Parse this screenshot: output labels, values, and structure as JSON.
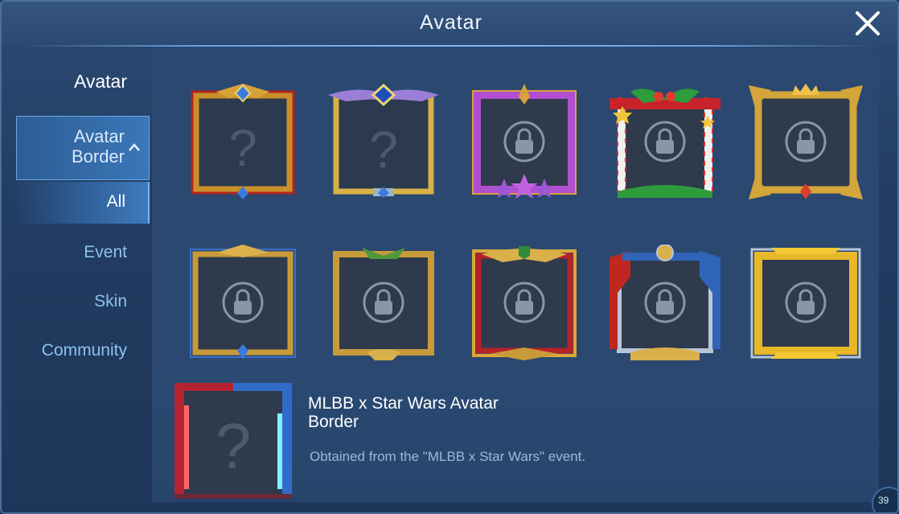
{
  "window": {
    "title": "Avatar"
  },
  "sidebar": {
    "avatar": "Avatar",
    "avatar_border_line1": "Avatar",
    "avatar_border_line2": "Border",
    "all": "All",
    "event": "Event",
    "skin": "Skin",
    "community": "Community"
  },
  "borders": [
    {
      "theme": "gold-red",
      "status": "unknown"
    },
    {
      "theme": "gold-wing",
      "status": "unknown"
    },
    {
      "theme": "purple-star",
      "status": "locked"
    },
    {
      "theme": "christmas",
      "status": "locked"
    },
    {
      "theme": "gold-crown",
      "status": "locked"
    },
    {
      "theme": "gold-blue",
      "status": "locked"
    },
    {
      "theme": "gold-green",
      "status": "locked"
    },
    {
      "theme": "red-gold",
      "status": "locked"
    },
    {
      "theme": "silver-red-blue",
      "status": "locked"
    },
    {
      "theme": "yellow-silver",
      "status": "locked"
    }
  ],
  "detail": {
    "name": "MLBB x Star Wars Avatar Border",
    "description": "Obtained from the \"MLBB x Star Wars\" event."
  },
  "corner_badge": "39",
  "colors": {
    "accent": "#3a77b9",
    "sidebar_text": "#8ec1ef",
    "gold": "#d9a83a",
    "panel_bg": "#2a4870"
  }
}
